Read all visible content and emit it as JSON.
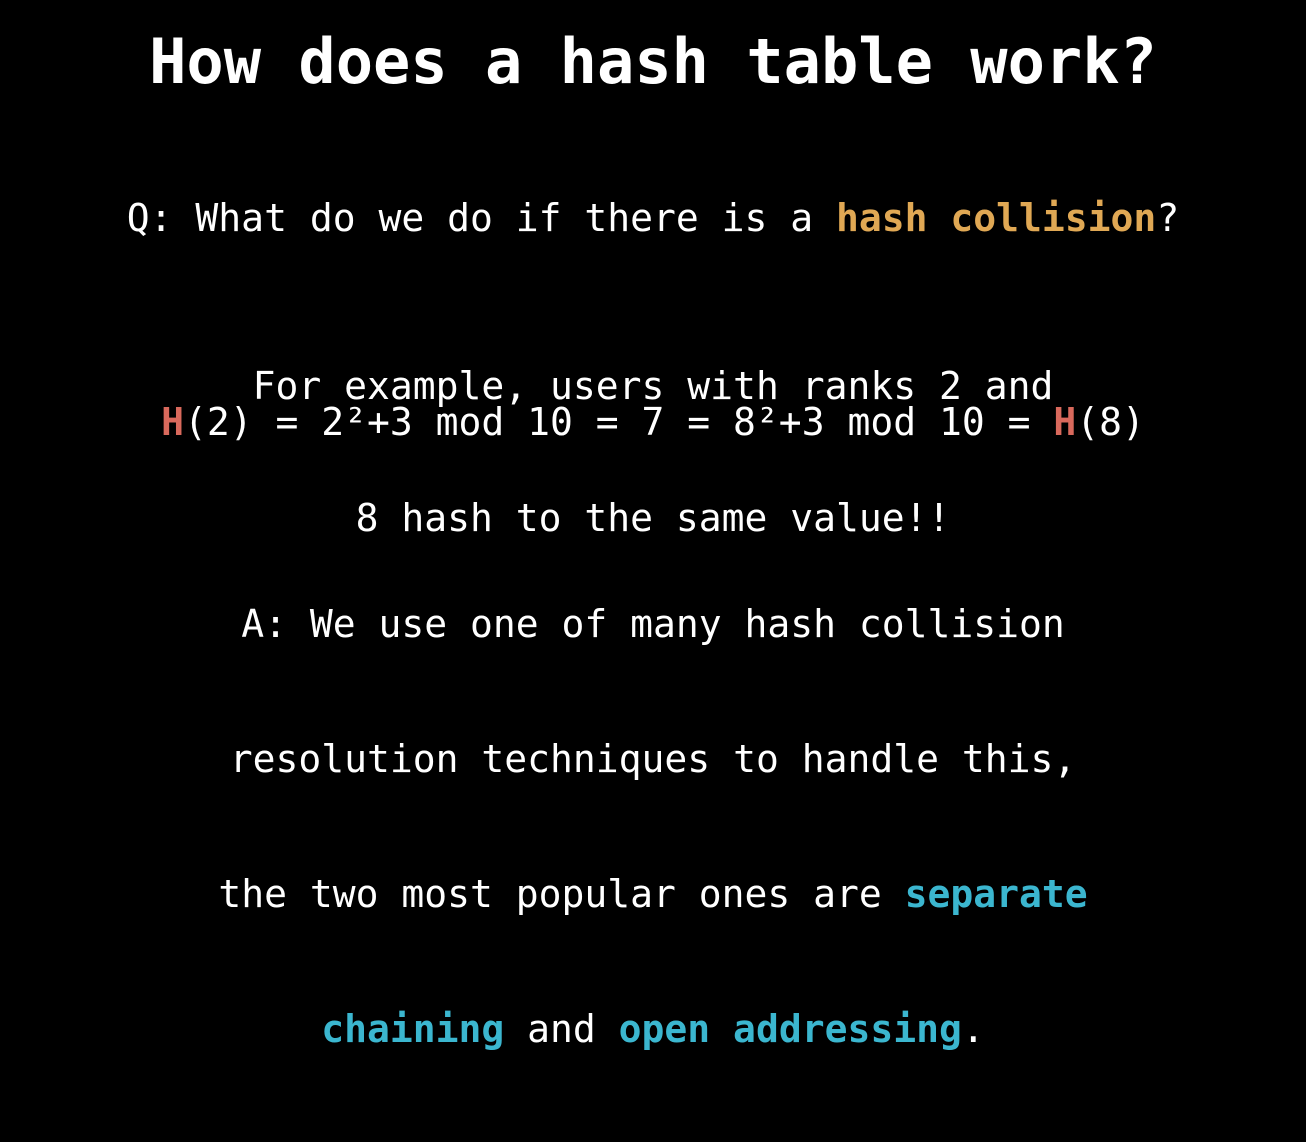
{
  "title": "How does a hash table work?",
  "question": {
    "prefix": "Q: What do we do if there is a ",
    "highlight": "hash collision",
    "suffix": "?"
  },
  "example": {
    "line1": "For example, users with ranks 2 and",
    "line2": "8 hash to the same value!!"
  },
  "formula": {
    "h_left": "H",
    "middle": "(2) = 2²+3 mod 10 = 7 = 8²+3 mod 10 = ",
    "h_right": "H",
    "end": "(8)"
  },
  "answer": {
    "line1": "A: We use one of many hash collision",
    "line2": "resolution techniques to handle this,",
    "line3_prefix": "the two most popular ones are ",
    "line3_highlight": "separate",
    "line4_highlight1": "chaining",
    "line4_middle": " and ",
    "line4_highlight2": "open addressing",
    "line4_suffix": "."
  },
  "colors": {
    "background": "#000000",
    "text": "#ffffff",
    "highlight_orange": "#e0a854",
    "highlight_red": "#d9695c",
    "highlight_cyan": "#3bb6cf"
  }
}
